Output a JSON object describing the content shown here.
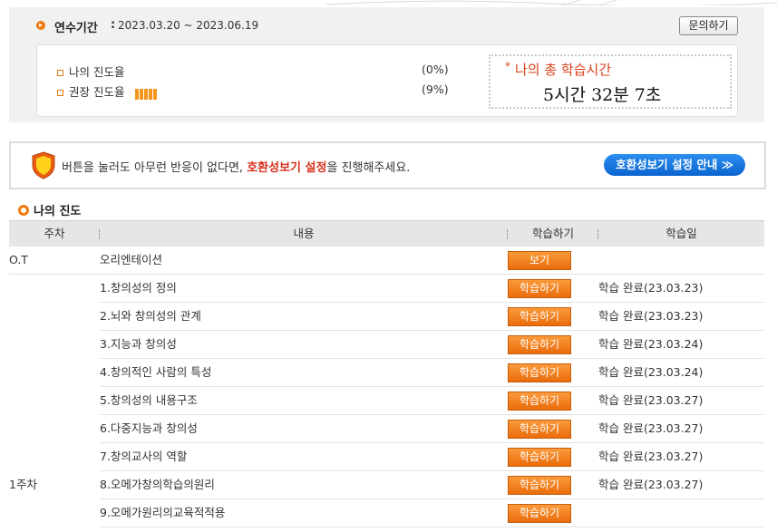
{
  "period": {
    "label": "연수기간",
    "colon": ":",
    "value": "2023.03.20 ~ 2023.06.19"
  },
  "inquiry_label": "문의하기",
  "progress": {
    "my_label": "나의 진도율",
    "my_value": "(0%)",
    "recommended_label": "권장 진도율",
    "recommended_value": "(9%)",
    "recommended_fraction": 0.09
  },
  "total_time": {
    "star": "*",
    "label": "나의 총 학습시간",
    "value": "5시간 32분 7초"
  },
  "notice": {
    "text_before": "버튼을 눌러도 아무런 반응이 없다면, ",
    "highlight": "호환성보기 설정",
    "text_after": "을 진행해주세요.",
    "guide_button": "호환성보기 설정 안내 ≫"
  },
  "section_title": "나의 진도",
  "table": {
    "headers": [
      "주차",
      "내용",
      "학습하기",
      "학습일"
    ],
    "rows": [
      {
        "week": "O.T",
        "content": "오리엔테이션",
        "button": "보기",
        "status": ""
      },
      {
        "week": "",
        "content": "1.창의성의 정의",
        "button": "학습하기",
        "status": "학습 완료(23.03.23)"
      },
      {
        "week": "",
        "content": "2.뇌와 창의성의 관계",
        "button": "학습하기",
        "status": "학습 완료(23.03.23)"
      },
      {
        "week": "",
        "content": "3.지능과 창의성",
        "button": "학습하기",
        "status": "학습 완료(23.03.24)"
      },
      {
        "week": "",
        "content": "4.창의적인 사람의 특성",
        "button": "학습하기",
        "status": "학습 완료(23.03.24)"
      },
      {
        "week": "",
        "content": "5.창의성의 내용구조",
        "button": "학습하기",
        "status": "학습 완료(23.03.27)"
      },
      {
        "week": "",
        "content": "6.다중지능과 창의성",
        "button": "학습하기",
        "status": "학습 완료(23.03.27)"
      },
      {
        "week": "",
        "content": "7.창의교사의 역할",
        "button": "학습하기",
        "status": "학습 완료(23.03.27)"
      },
      {
        "week": "",
        "content": "8.오메가창의학습의원리",
        "button": "학습하기",
        "status": "학습 완료(23.03.27)"
      },
      {
        "week": "",
        "content": "9.오메가원리의교육적적용",
        "button": "학습하기",
        "status": ""
      }
    ],
    "week_1_label": "1주차"
  },
  "colors": {
    "accent_orange": "#f07a10",
    "highlight_red": "#d7301e",
    "guide_blue": "#0b64cf"
  }
}
